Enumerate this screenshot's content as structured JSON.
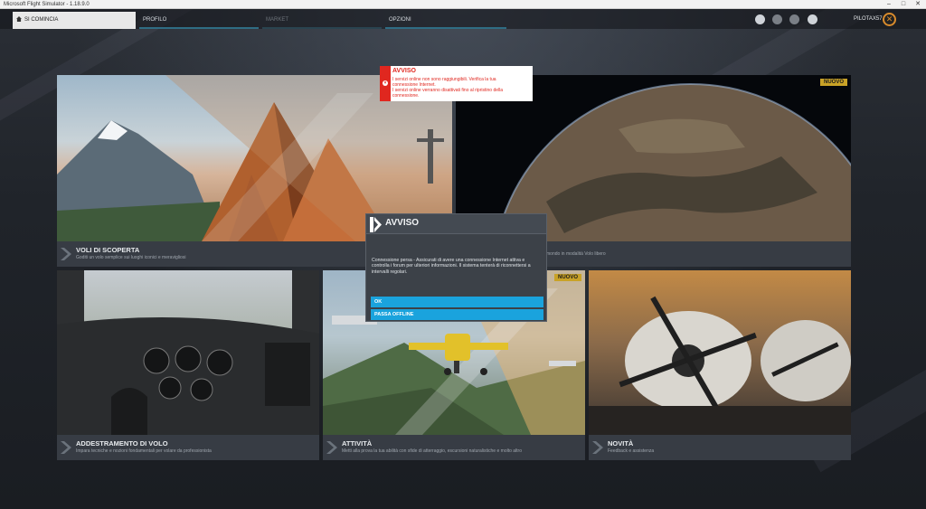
{
  "window": {
    "title": "Microsoft Flight Simulator - 1.18.9.0"
  },
  "nav": {
    "tabs": [
      {
        "label": "SI COMINCIA"
      },
      {
        "label": "PROFILO"
      },
      {
        "label": "MARKET"
      },
      {
        "label": "OPZIONI"
      }
    ],
    "username": "PILOTAX57"
  },
  "tiles": {
    "discovery": {
      "title": "VOLI DI SCOPERTA",
      "subtitle": "Goditi un volo semplice sui luoghi iconici e meravigliosi"
    },
    "world_map": {
      "badge": "NUOVO",
      "subtitle": "mondo in modalità Volo libero"
    },
    "training": {
      "title": "ADDESTRAMENTO DI VOLO",
      "subtitle": "Impara tecniche e nozioni fondamentali per volare da professionista"
    },
    "activities": {
      "badge": "NUOVO",
      "title": "ATTIVITÀ",
      "subtitle": "Metti alla prova la tua abilità con sfide di atterraggio, escursioni naturalistiche e molto altro"
    },
    "news": {
      "title": "NOVITÀ",
      "subtitle": "Feedback e assistenza"
    }
  },
  "toast": {
    "title": "AVVISO",
    "line1": "I servizi online non sono raggiungibili. Verifica la tua",
    "line2": "connessione Internet.",
    "line3": "I servizi online verranno disattivati fino al ripristino della",
    "line4": "connessione."
  },
  "dialog": {
    "title": "AVVISO",
    "body": "Connessione persa - Assicurati di avere una connessione Internet attiva e controlla i forum per ulteriori informazioni. Il sistema tenterà di riconnettersi a intervalli regolari.",
    "ok_label": "OK",
    "offline_label": "PASSA OFFLINE"
  },
  "colors": {
    "accent": "#1aa3dd",
    "error": "#e0271f",
    "badge": "#c9a227",
    "user_ring": "#d88b2c"
  }
}
